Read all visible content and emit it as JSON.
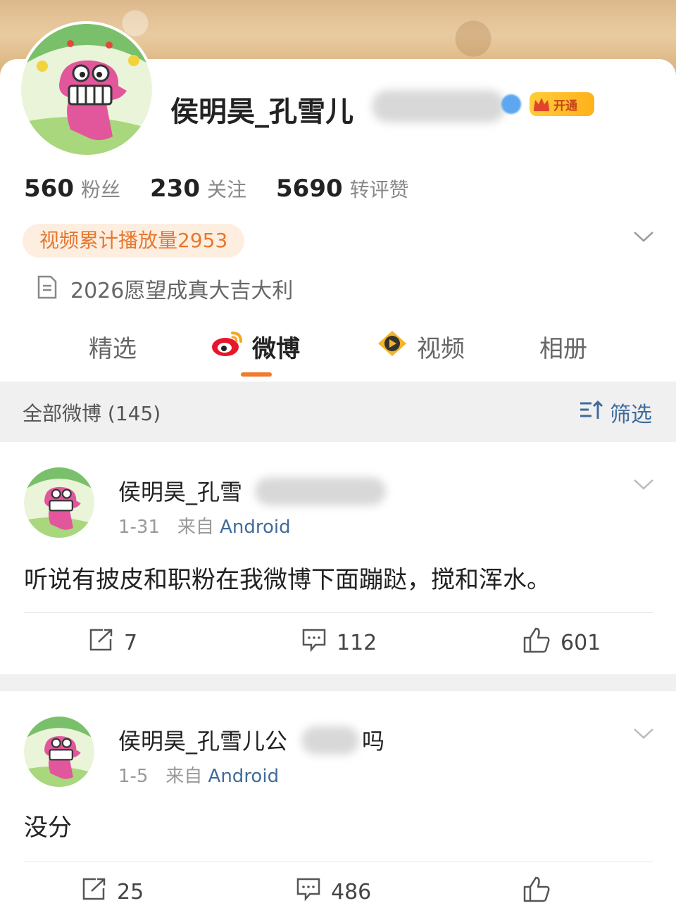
{
  "profile": {
    "name_visible": "侯明昊_孔雪儿",
    "vip_label": "开通",
    "stats": [
      {
        "num": "560",
        "label": "粉丝"
      },
      {
        "num": "230",
        "label": "关注"
      },
      {
        "num": "5690",
        "label": "转评赞"
      }
    ],
    "play_count": "视频累计播放量2953",
    "bio": "2026愿望成真大吉大利"
  },
  "tabs": [
    {
      "label": "精选"
    },
    {
      "label": "微博"
    },
    {
      "label": "视频"
    },
    {
      "label": "相册"
    }
  ],
  "filter": {
    "count_label": "全部微博 (145)",
    "button_label": "筛选"
  },
  "posts": [
    {
      "author_visible": "侯明昊_孔雪",
      "date": "1-31",
      "source_prefix": "来自",
      "source": "Android",
      "text": "听说有披皮和职粉在我微博下面蹦跶，搅和浑水。",
      "reposts": "7",
      "comments": "112",
      "likes": "601"
    },
    {
      "author_visible": "侯明昊_孔雪儿公",
      "author_suffix": "吗",
      "date": "1-5",
      "source_prefix": "来自",
      "source": "Android",
      "text": "没分",
      "reposts": "25",
      "comments": "486"
    }
  ],
  "colors": {
    "accent": "#f27a2b",
    "link": "#3f6b9b",
    "vip": "#ffb11a",
    "badge_bg": "#fdeee0"
  }
}
